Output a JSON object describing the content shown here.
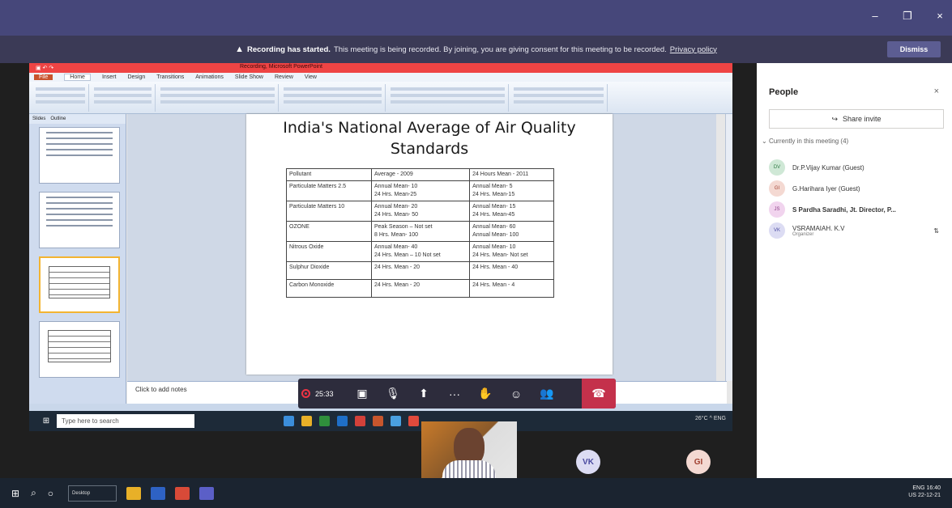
{
  "window": {
    "min": "–",
    "max": "❐",
    "close": "×"
  },
  "banner": {
    "strong": "Recording has started.",
    "text": "This meeting is being recorded. By joining, you are giving consent for this meeting to be recorded.",
    "link": "Privacy policy",
    "dismiss": "Dismiss"
  },
  "ppt": {
    "title": "Recording, Microsoft PowerPoint",
    "tabs": [
      "File",
      "Home",
      "Insert",
      "Design",
      "Transitions",
      "Animations",
      "Slide Show",
      "Review",
      "View"
    ],
    "left_tabs": [
      "Slides",
      "Outline"
    ],
    "slide_title_1": "India's National Average of Air Quality",
    "slide_title_2": "Standards",
    "notes": "Click to add notes",
    "table": {
      "header": [
        "Pollutant",
        "Average - 2009",
        "24 Hours Mean - 2011"
      ],
      "rows": [
        [
          "Particulate Matters 2.5",
          "Annual Mean- 10\n24 Hrs. Mean-25",
          "Annual Mean- 5\n24 Hrs. Mean-15"
        ],
        [
          "Particulate Matters 10",
          "Annual Mean- 20\n24 Hrs. Mean- 50",
          "Annual Mean- 15\n24 Hrs. Mean-45"
        ],
        [
          "OZONE",
          "Peak Season – Not set\n8 Hrs. Mean- 100",
          "Annual Mean- 60\nAnnual Mean- 100"
        ],
        [
          "Nitrous Oxide",
          "Annual Mean- 40\n24 Hrs. Mean – 10 Not set",
          "Annual Mean- 10\n24 Hrs. Mean- Not set"
        ],
        [
          "Sulphur Dioxide",
          "24 Hrs. Mean - 20",
          "24 Hrs. Mean - 40"
        ],
        [
          "Carbon Monoxide",
          "24 Hrs. Mean - 20",
          "24 Hrs. Mean - 4"
        ]
      ]
    }
  },
  "inner_taskbar": {
    "search": "Type here to search",
    "tray": "26°C  ^  ENG"
  },
  "controls": {
    "timer": "25:33"
  },
  "participants_strip": {
    "vk": "VK",
    "gi": "GI"
  },
  "people": {
    "title": "People",
    "share_invite": "Share invite",
    "section": "Currently in this meeting (4)",
    "list": [
      {
        "initials": "DV",
        "name": "Dr.P.Vijay Kumar (Guest)",
        "color": "#cfe8d6",
        "fg": "#2f7a44"
      },
      {
        "initials": "GI",
        "name": "G.Harihara Iyer (Guest)",
        "color": "#f4d9d2",
        "fg": "#a04030"
      },
      {
        "initials": "JS",
        "name": "S Pardha Saradhi, Jt. Director, P...",
        "color": "#f1d4ee",
        "fg": "#8a3b84"
      },
      {
        "initials": "VK",
        "name": "VSRAMAIAH. K.V",
        "sub": "Organizer",
        "color": "#dcdcf3",
        "fg": "#4b4ba0"
      }
    ]
  },
  "os_taskbar": {
    "box": "Desktop",
    "tray1": "ENG  16:40",
    "tray2": "US  22-12-21"
  }
}
